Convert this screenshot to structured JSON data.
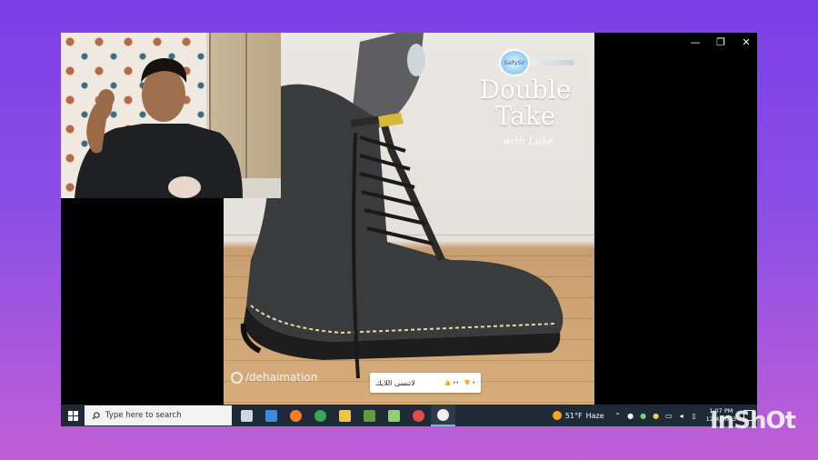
{
  "window": {
    "controls": [
      "—",
      "❐",
      "✕"
    ]
  },
  "video": {
    "logo_badge_text": "SaltySir",
    "title_line1": "Double",
    "title_line2": "Take",
    "subtitle": "with Luke",
    "watermark": "/dehaimation",
    "caption": "لاتنسى اللايك",
    "caption_likes": "👍 ••",
    "caption_dislikes": "👎 •"
  },
  "taskbar": {
    "search_placeholder": "Type here to search",
    "apps": [
      {
        "name": "task-view",
        "color": "#cfd8e3"
      },
      {
        "name": "mail",
        "color": "#3a8dde"
      },
      {
        "name": "firefox",
        "color": "#ff7b24"
      },
      {
        "name": "chrome",
        "color": "#34a853"
      },
      {
        "name": "file-explorer",
        "color": "#f3c53a"
      },
      {
        "name": "minecraft",
        "color": "#5f9e3a"
      },
      {
        "name": "android-app",
        "color": "#8fd16b"
      },
      {
        "name": "screen-recorder",
        "color": "#e24b4b"
      },
      {
        "name": "media-player",
        "color": "#f0f0f0"
      }
    ],
    "weather_temp": "51°F",
    "weather_desc": "Haze",
    "time": "1:07 PM",
    "date": "12/4/2023"
  },
  "overlay": {
    "brand": "InShOt"
  }
}
